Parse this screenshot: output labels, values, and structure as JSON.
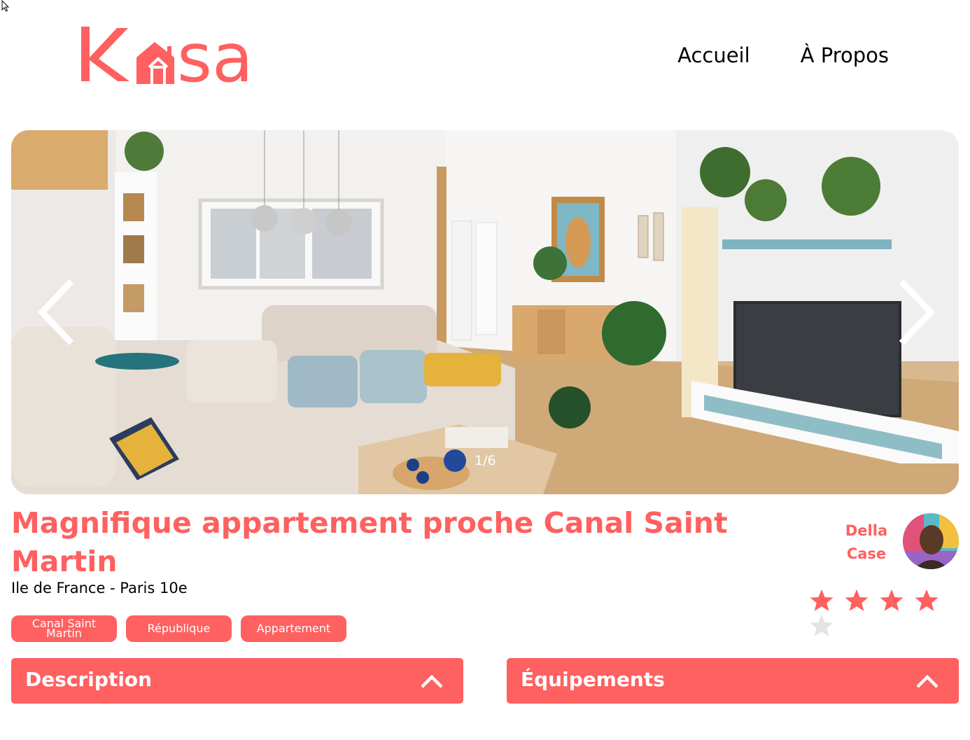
{
  "brand": {
    "name": "Kasa",
    "color": "#ff6060"
  },
  "nav": {
    "home": "Accueil",
    "about": "À Propos"
  },
  "gallery": {
    "counter": "1/6",
    "prev_icon": "chevron-left-icon",
    "next_icon": "chevron-right-icon"
  },
  "listing": {
    "title": "Magnifique appartement proche Canal Saint Martin",
    "location": "Ile de France - Paris 10e",
    "tags": [
      "Canal Saint Martin",
      "République",
      "Appartement"
    ],
    "rating": 4,
    "rating_max": 5
  },
  "host": {
    "first_name": "Della",
    "last_name": "Case"
  },
  "sections": {
    "description": {
      "title": "Description",
      "icon": "chevron-up-icon"
    },
    "equipments": {
      "title": "Équipements",
      "icon": "chevron-up-icon"
    }
  },
  "colors": {
    "accent": "#ff6060",
    "star_inactive": "#e3e3e3",
    "white": "#ffffff"
  }
}
